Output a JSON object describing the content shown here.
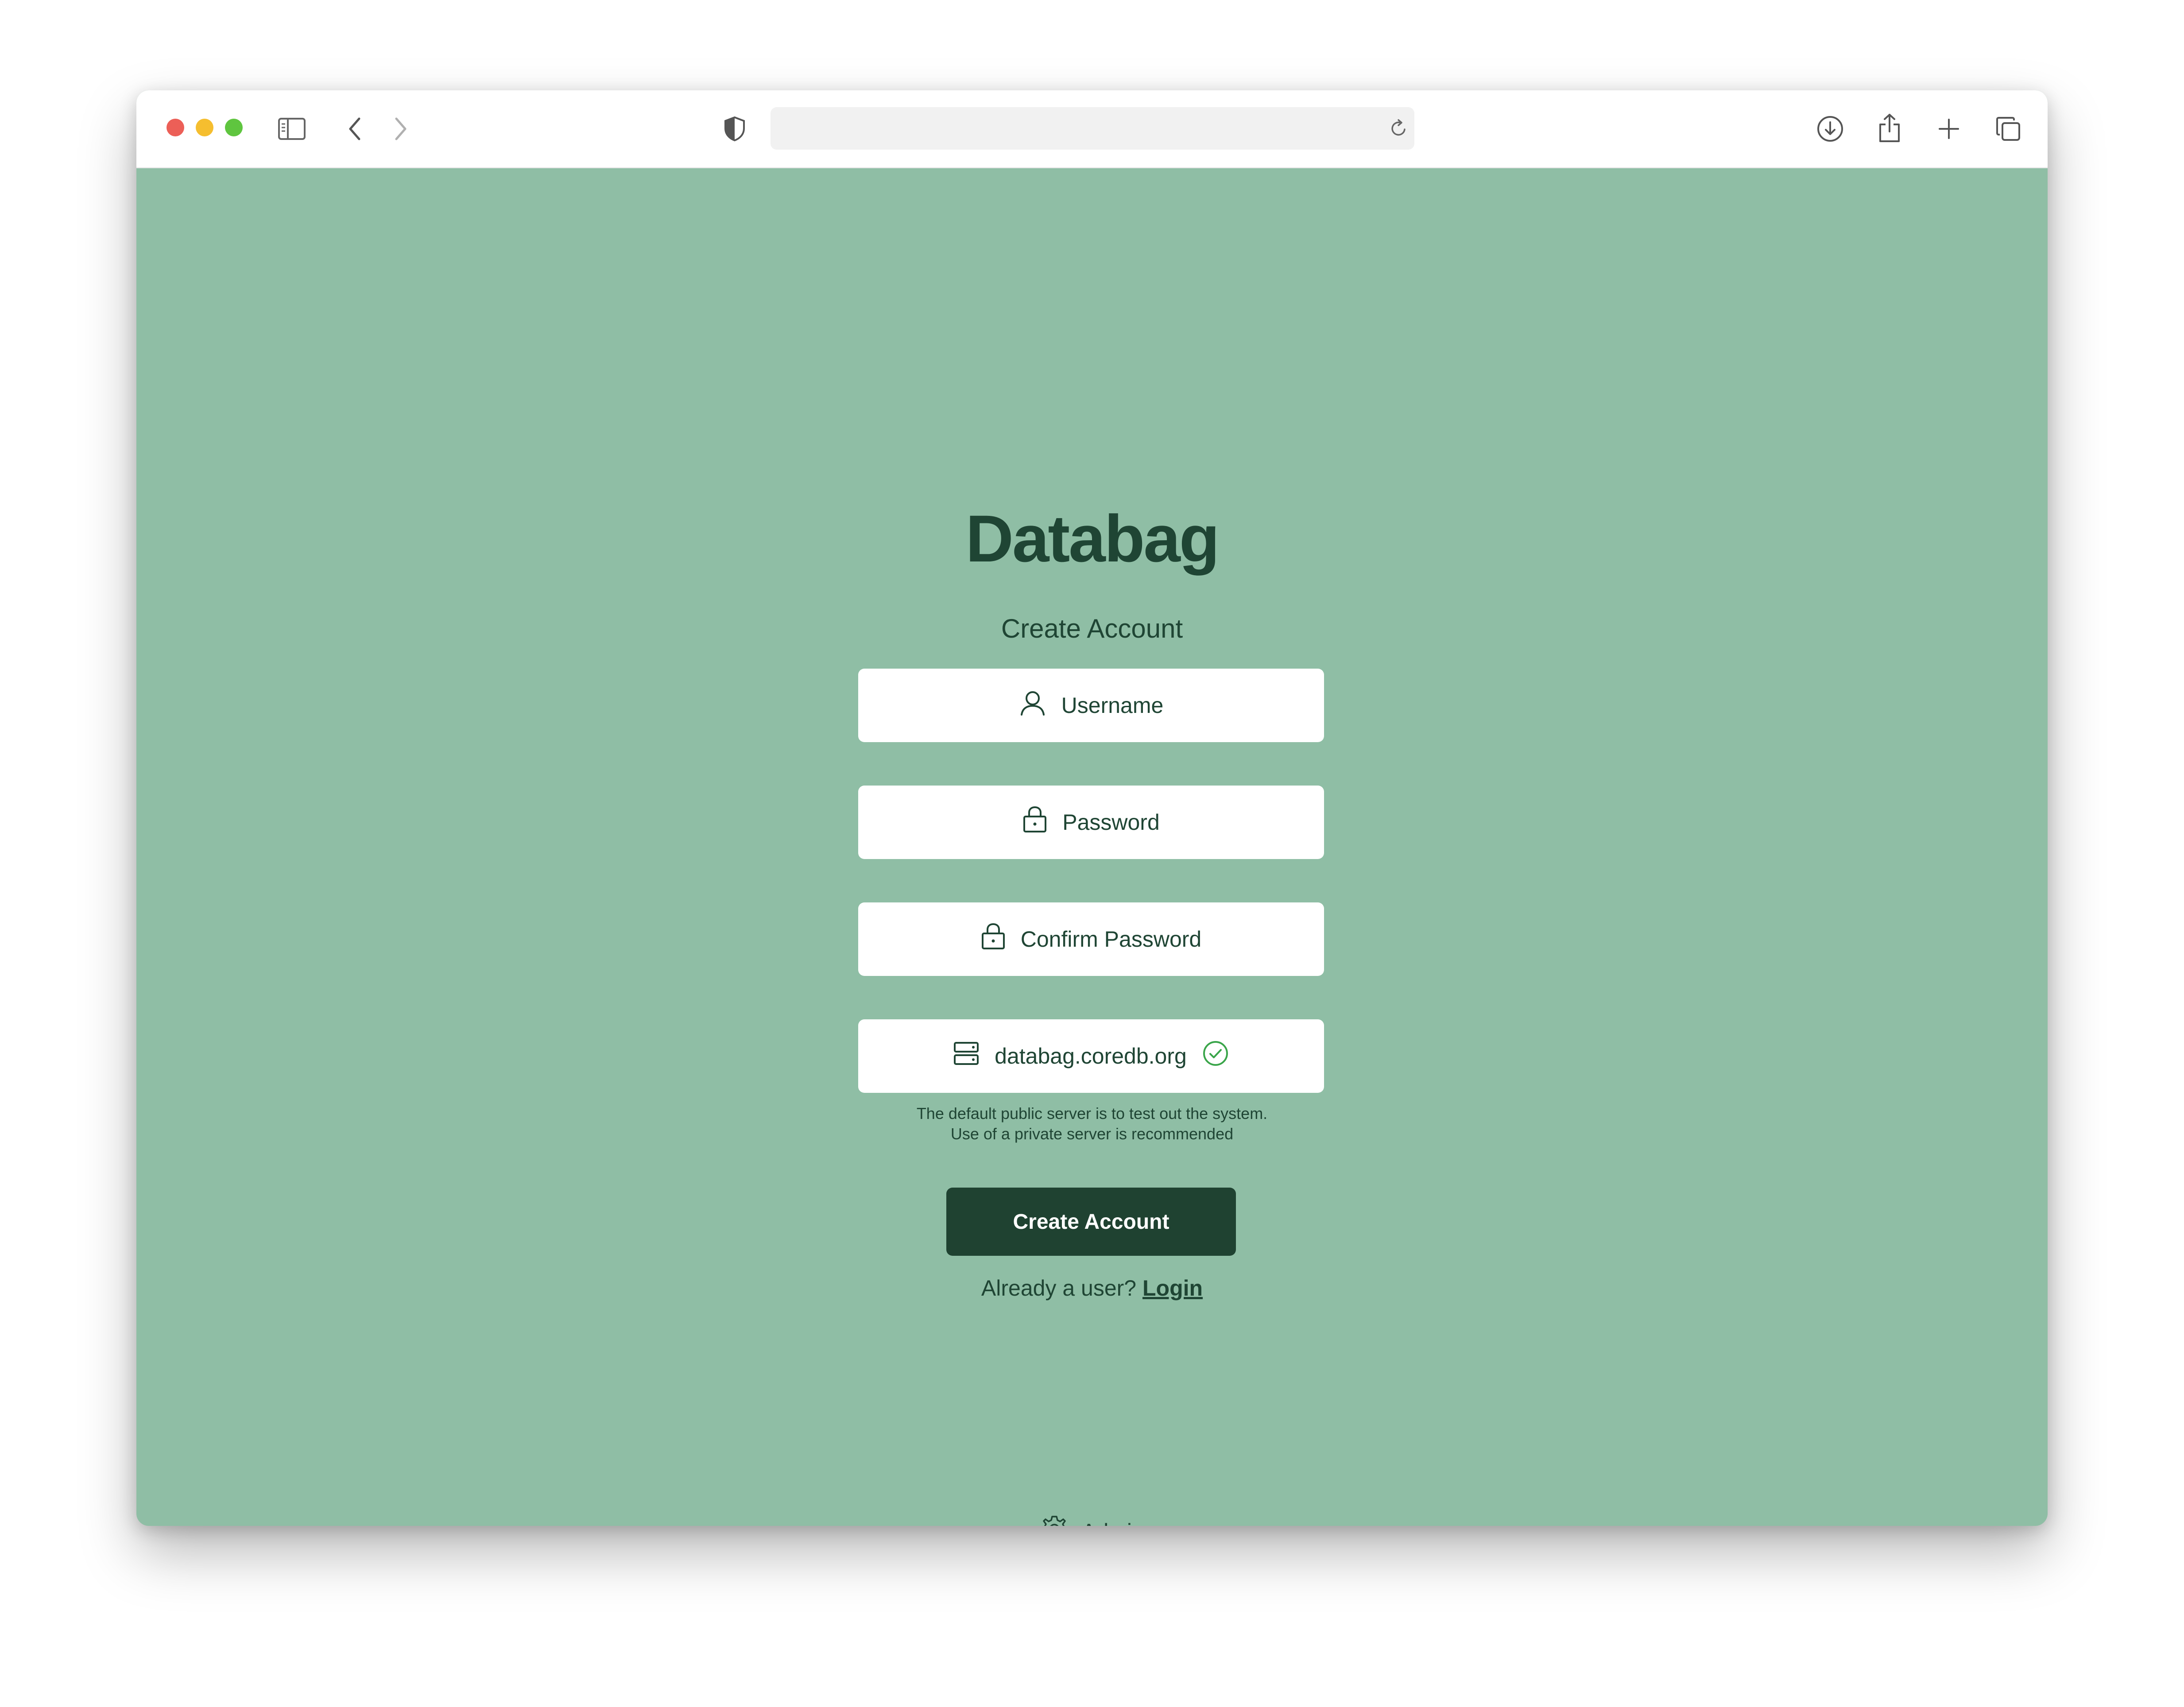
{
  "browser": {
    "traffic_lights": {
      "close": "#ec5f57",
      "minimize": "#f5be2f",
      "zoom": "#5fc53f"
    },
    "icons": [
      "sidebar-icon",
      "back-icon",
      "forward-icon",
      "shield-icon",
      "reload-icon",
      "download-icon",
      "share-icon",
      "new-tab-icon",
      "tabs-icon"
    ],
    "address_value": ""
  },
  "app": {
    "logo": "Databag",
    "subtitle": "Create Account",
    "background": "#8fbea5",
    "accent": "#1f4231"
  },
  "form": {
    "username_placeholder": "Username",
    "password_placeholder": "Password",
    "confirm_placeholder": "Confirm Password",
    "server_value": "databag.coredb.org",
    "server_status_color": "#3aa54a",
    "hint_line1": "The default public server is to test out the system.",
    "hint_line2": "Use of a private server is recommended",
    "submit_label": "Create Account"
  },
  "footer": {
    "login_prompt": "Already a user?",
    "login_link": "Login",
    "admin_label": "Admin"
  }
}
